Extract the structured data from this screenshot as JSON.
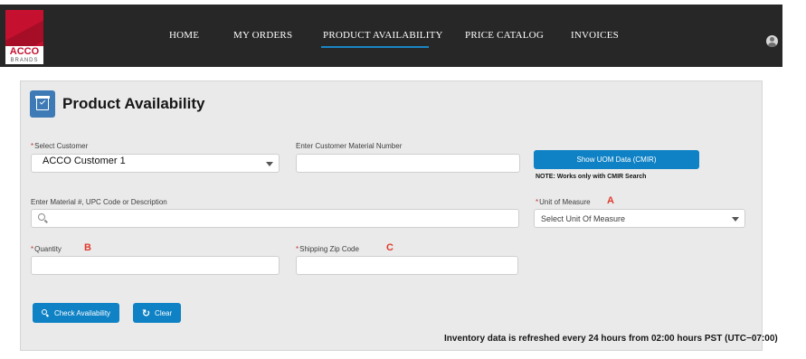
{
  "brand": {
    "logo_text": "ACCO",
    "logo_subtext": "BRANDS",
    "color": "#c5102f"
  },
  "nav": {
    "items": [
      {
        "label": "HOME"
      },
      {
        "label": "MY ORDERS"
      },
      {
        "label": "PRODUCT AVAILABILITY",
        "active": true
      },
      {
        "label": "PRICE CATALOG"
      },
      {
        "label": "INVOICES"
      }
    ],
    "active_color": "#1a86c4",
    "user_icon": "user-avatar-icon"
  },
  "page": {
    "title": "Product Availability",
    "title_icon": "calendar-check-icon"
  },
  "form": {
    "customer": {
      "label": "Select Customer",
      "value": "ACCO Customer 1"
    },
    "cmir": {
      "label": "Enter Customer Material Number",
      "value": ""
    },
    "uom_button": {
      "label": "Show UOM Data (CMIR)",
      "note": "NOTE: Works only with CMIR Search"
    },
    "material": {
      "label": "Enter Material #, UPC Code or Description",
      "value": ""
    },
    "uom": {
      "label": "Unit of Measure",
      "marker": "A",
      "placeholder": "Select Unit Of Measure"
    },
    "quantity": {
      "label": "Quantity",
      "marker": "B",
      "value": ""
    },
    "zip": {
      "label": "Shipping Zip Code",
      "marker": "C",
      "value": ""
    },
    "required_mark": "*"
  },
  "actions": {
    "check": "Check Availability",
    "clear": "Clear"
  },
  "footer": {
    "refresh_note": "Inventory data is refreshed every 24 hours from 02:00 hours PST (UTC−07:00)"
  },
  "colors": {
    "header_bg": "#272727",
    "panel_bg": "#eaeaea",
    "button": "#0f82c5",
    "marker": "#e03a2c"
  }
}
